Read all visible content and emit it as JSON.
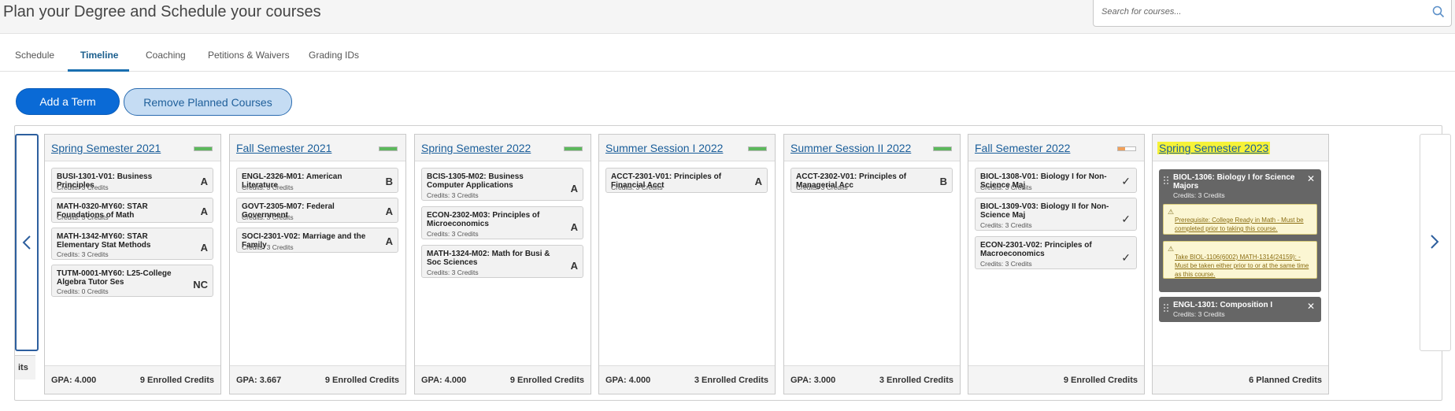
{
  "header": {
    "title": "Plan your Degree and Schedule your courses",
    "search_placeholder": "Search for courses...",
    "search_icon": "search-icon"
  },
  "tabs": [
    {
      "label": "Schedule",
      "active": false
    },
    {
      "label": "Timeline",
      "active": true
    },
    {
      "label": "Coaching",
      "active": false
    },
    {
      "label": "Petitions & Waivers",
      "active": false
    },
    {
      "label": "Grading IDs",
      "active": false
    }
  ],
  "actions": {
    "add_term": "Add a Term",
    "remove_planned": "Remove Planned Courses"
  },
  "colors": {
    "accent": "#0a6ad6",
    "progress_complete": "#5cb85c",
    "progress_partial": "#f0a05a",
    "highlight": "#f6f238",
    "planned_card": "#666666",
    "warning_bg": "#fbf6d3"
  },
  "partial_term_footer": "its",
  "terms": [
    {
      "title": "Spring Semester 2021",
      "progress": 1.0,
      "courses": [
        {
          "name": "BUSI-1301-V01: Business Principles",
          "credits": "Credits: 3 Credits",
          "grade": "A"
        },
        {
          "name": "MATH-0320-MY60: STAR Foundations of Math",
          "credits": "Credits: 3 Credits",
          "grade": "A"
        },
        {
          "name": "MATH-1342-MY60: STAR Elementary Stat Methods",
          "credits": "Credits: 3 Credits",
          "grade": "A"
        },
        {
          "name": "TUTM-0001-MY60: L25-College Algebra Tutor Ses",
          "credits": "Credits: 0 Credits",
          "grade": "NC"
        }
      ],
      "gpa": "GPA: 4.000",
      "credits_summary": "9 Enrolled Credits"
    },
    {
      "title": "Fall Semester 2021",
      "progress": 1.0,
      "courses": [
        {
          "name": "ENGL-2326-M01: American Literature",
          "credits": "Credits: 3 Credits",
          "grade": "B"
        },
        {
          "name": "GOVT-2305-M07: Federal Government",
          "credits": "Credits: 3 Credits",
          "grade": "A"
        },
        {
          "name": "SOCI-2301-V02: Marriage and the Family",
          "credits": "Credits: 3 Credits",
          "grade": "A"
        }
      ],
      "gpa": "GPA: 3.667",
      "credits_summary": "9 Enrolled Credits"
    },
    {
      "title": "Spring Semester 2022",
      "progress": 1.0,
      "courses": [
        {
          "name": "BCIS-1305-M02: Business Computer Applications",
          "credits": "Credits: 3 Credits",
          "grade": "A"
        },
        {
          "name": "ECON-2302-M03: Principles of Microeconomics",
          "credits": "Credits: 3 Credits",
          "grade": "A"
        },
        {
          "name": "MATH-1324-M02: Math for Busi & Soc Sciences",
          "credits": "Credits: 3 Credits",
          "grade": "A"
        }
      ],
      "gpa": "GPA: 4.000",
      "credits_summary": "9 Enrolled Credits"
    },
    {
      "title": "Summer Session I 2022",
      "progress": 1.0,
      "courses": [
        {
          "name": "ACCT-2301-V01: Principles of Financial Acct",
          "credits": "Credits: 3 Credits",
          "grade": "A"
        }
      ],
      "gpa": "GPA: 4.000",
      "credits_summary": "3 Enrolled Credits"
    },
    {
      "title": "Summer Session II 2022",
      "progress": 1.0,
      "courses": [
        {
          "name": "ACCT-2302-V01: Principles of Managerial Acc",
          "credits": "Credits: 3 Credits",
          "grade": "B"
        }
      ],
      "gpa": "GPA: 3.000",
      "credits_summary": "3 Enrolled Credits"
    },
    {
      "title": "Fall Semester 2022",
      "progress": 0.4,
      "courses": [
        {
          "name": "BIOL-1308-V01: Biology I for Non-Science Maj",
          "credits": "Credits: 3 Credits",
          "status": "check-icon"
        },
        {
          "name": "BIOL-1309-V03: Biology II for Non-Science Maj",
          "credits": "Credits: 3 Credits",
          "status": "check-icon"
        },
        {
          "name": "ECON-2301-V02: Principles of Macroeconomics",
          "credits": "Credits: 3 Credits",
          "status": "check-icon"
        }
      ],
      "gpa": "",
      "credits_summary": "9 Enrolled Credits"
    },
    {
      "title": "Spring Semester 2023",
      "highlighted": true,
      "planned": [
        {
          "name": "BIOL-1306: Biology I for Science Majors",
          "credits": "Credits: 3 Credits",
          "warnings": [
            "Prerequisite: College Ready in Math - Must be completed prior to taking this course.",
            "Take BIOL-1106(6002) MATH-1314(24159): - Must be taken either prior to or at the same time as this course."
          ]
        },
        {
          "name": "ENGL-1301: Composition I",
          "credits": "Credits: 3 Credits",
          "warnings": []
        }
      ],
      "gpa": "",
      "credits_summary": "6 Planned Credits"
    }
  ]
}
